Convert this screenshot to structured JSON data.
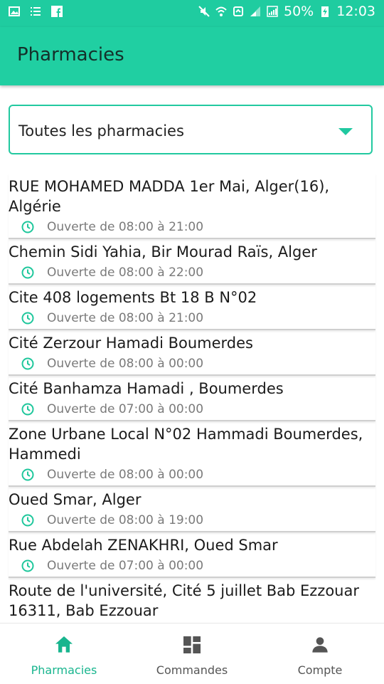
{
  "status_bar": {
    "battery": "50%",
    "time": "12:03"
  },
  "app_bar": {
    "title": "Pharmacies"
  },
  "filter": {
    "selected": "Toutes les pharmacies"
  },
  "pharmacies": [
    {
      "address": "RUE MOHAMED MADDA 1er Mai, Alger(16), Algérie",
      "hours": "Ouverte de 08:00 à 21:00"
    },
    {
      "address": "Chemin Sidi Yahia, Bir Mourad Raïs, Alger",
      "hours": "Ouverte de 08:00 à 22:00"
    },
    {
      "address": "Cite 408 logements Bt 18 B N°02",
      "hours": "Ouverte de 08:00 à 21:00"
    },
    {
      "address": "Cité Zerzour Hamadi Boumerdes",
      "hours": "Ouverte de 08:00 à 00:00"
    },
    {
      "address": "Cité Banhamza Hamadi , Boumerdes",
      "hours": "Ouverte de 07:00 à 00:00"
    },
    {
      "address": "Zone Urbane Local N°02 Hammadi Boumerdes, Hammedi",
      "hours": "Ouverte de 08:00 à 00:00"
    },
    {
      "address": "Oued Smar, Alger",
      "hours": "Ouverte de 08:00 à 19:00"
    },
    {
      "address": "Rue Abdelah ZENAKHRI, Oued Smar",
      "hours": "Ouverte de 07:00 à 00:00"
    },
    {
      "address": "Route de l'université, Cité 5 juillet Bab Ezzouar 16311, Bab Ezzouar",
      "hours": ""
    }
  ],
  "bottom_nav": {
    "items": [
      {
        "label": "Pharmacies",
        "icon": "home-icon",
        "active": true
      },
      {
        "label": "Commandes",
        "icon": "dashboard-icon",
        "active": false
      },
      {
        "label": "Compte",
        "icon": "person-icon",
        "active": false
      }
    ]
  },
  "colors": {
    "primary": "#20cfa2",
    "accent": "#18b58e"
  }
}
